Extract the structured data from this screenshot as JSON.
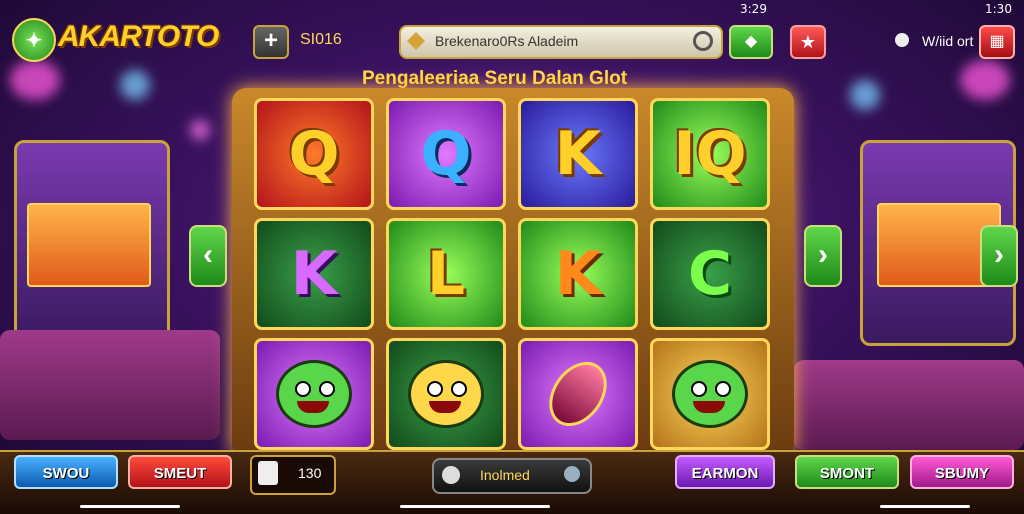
{
  "status_bar": {
    "time": "1:30",
    "center_time": "3:29"
  },
  "header": {
    "logo_text": "AKARTOTO",
    "balance": "SI016",
    "search_value": "Brekenaro0Rs Aladeim",
    "user_label": "W/iid ort"
  },
  "title": "Pengaleeriaa Seru Dalan Glot",
  "grid": {
    "row1": [
      "Q",
      "Q",
      "K",
      "IQ"
    ],
    "row2": [
      "K",
      "L",
      "K",
      "C"
    ]
  },
  "footer": {
    "btn1": "SWOU",
    "btn2": "SMEUT",
    "bet_value": "130",
    "info_text": "Inolmed",
    "btn3": "EARMON",
    "btn4": "SMONT",
    "btn5": "SBUMY"
  },
  "colors": {
    "gold": "#ffcf2a",
    "accent_green": "#1f8a1a",
    "accent_red": "#b3121a"
  }
}
